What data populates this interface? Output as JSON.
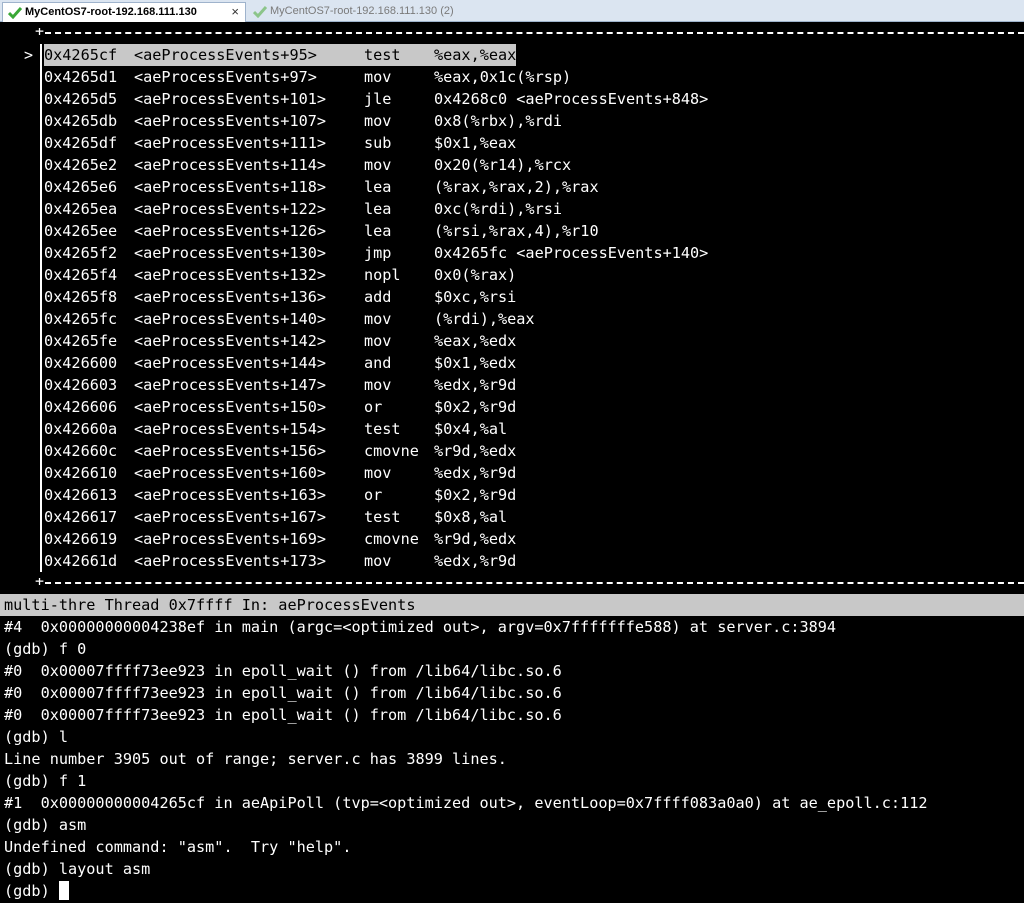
{
  "tabs": [
    {
      "label": "MyCentOS7-root-192.168.111.130",
      "close": "×",
      "active": true
    },
    {
      "label": "MyCentOS7-root-192.168.111.130 (2)",
      "active": false
    }
  ],
  "asm": {
    "current_marker": ">",
    "rows": [
      {
        "addr": "0x4265cf",
        "sym": "<aeProcessEvents+95>",
        "op": "test",
        "args": "%eax,%eax"
      },
      {
        "addr": "0x4265d1",
        "sym": "<aeProcessEvents+97>",
        "op": "mov",
        "args": "%eax,0x1c(%rsp)"
      },
      {
        "addr": "0x4265d5",
        "sym": "<aeProcessEvents+101>",
        "op": "jle",
        "args": "0x4268c0 <aeProcessEvents+848>"
      },
      {
        "addr": "0x4265db",
        "sym": "<aeProcessEvents+107>",
        "op": "mov",
        "args": "0x8(%rbx),%rdi"
      },
      {
        "addr": "0x4265df",
        "sym": "<aeProcessEvents+111>",
        "op": "sub",
        "args": "$0x1,%eax"
      },
      {
        "addr": "0x4265e2",
        "sym": "<aeProcessEvents+114>",
        "op": "mov",
        "args": "0x20(%r14),%rcx"
      },
      {
        "addr": "0x4265e6",
        "sym": "<aeProcessEvents+118>",
        "op": "lea",
        "args": "(%rax,%rax,2),%rax"
      },
      {
        "addr": "0x4265ea",
        "sym": "<aeProcessEvents+122>",
        "op": "lea",
        "args": "0xc(%rdi),%rsi"
      },
      {
        "addr": "0x4265ee",
        "sym": "<aeProcessEvents+126>",
        "op": "lea",
        "args": "(%rsi,%rax,4),%r10"
      },
      {
        "addr": "0x4265f2",
        "sym": "<aeProcessEvents+130>",
        "op": "jmp",
        "args": "0x4265fc <aeProcessEvents+140>"
      },
      {
        "addr": "0x4265f4",
        "sym": "<aeProcessEvents+132>",
        "op": "nopl",
        "args": "0x0(%rax)"
      },
      {
        "addr": "0x4265f8",
        "sym": "<aeProcessEvents+136>",
        "op": "add",
        "args": "$0xc,%rsi"
      },
      {
        "addr": "0x4265fc",
        "sym": "<aeProcessEvents+140>",
        "op": "mov",
        "args": "(%rdi),%eax"
      },
      {
        "addr": "0x4265fe",
        "sym": "<aeProcessEvents+142>",
        "op": "mov",
        "args": "%eax,%edx"
      },
      {
        "addr": "0x426600",
        "sym": "<aeProcessEvents+144>",
        "op": "and",
        "args": "$0x1,%edx"
      },
      {
        "addr": "0x426603",
        "sym": "<aeProcessEvents+147>",
        "op": "mov",
        "args": "%edx,%r9d"
      },
      {
        "addr": "0x426606",
        "sym": "<aeProcessEvents+150>",
        "op": "or",
        "args": "$0x2,%r9d"
      },
      {
        "addr": "0x42660a",
        "sym": "<aeProcessEvents+154>",
        "op": "test",
        "args": "$0x4,%al"
      },
      {
        "addr": "0x42660c",
        "sym": "<aeProcessEvents+156>",
        "op": "cmovne",
        "args": "%r9d,%edx"
      },
      {
        "addr": "0x426610",
        "sym": "<aeProcessEvents+160>",
        "op": "mov",
        "args": "%edx,%r9d"
      },
      {
        "addr": "0x426613",
        "sym": "<aeProcessEvents+163>",
        "op": "or",
        "args": "$0x2,%r9d"
      },
      {
        "addr": "0x426617",
        "sym": "<aeProcessEvents+167>",
        "op": "test",
        "args": "$0x8,%al"
      },
      {
        "addr": "0x426619",
        "sym": "<aeProcessEvents+169>",
        "op": "cmovne",
        "args": "%r9d,%edx"
      },
      {
        "addr": "0x42661d",
        "sym": "<aeProcessEvents+173>",
        "op": "mov",
        "args": "%edx,%r9d"
      }
    ]
  },
  "status_line": "multi-thre Thread 0x7ffff In: aeProcessEvents",
  "command_lines": [
    "#4  0x00000000004238ef in main (argc=<optimized out>, argv=0x7fffffffe588) at server.c:3894",
    "(gdb) f 0",
    "#0  0x00007ffff73ee923 in epoll_wait () from /lib64/libc.so.6",
    "#0  0x00007ffff73ee923 in epoll_wait () from /lib64/libc.so.6",
    "#0  0x00007ffff73ee923 in epoll_wait () from /lib64/libc.so.6",
    "(gdb) l",
    "Line number 3905 out of range; server.c has 3899 lines.",
    "(gdb) f 1",
    "#1  0x00000000004265cf in aeApiPoll (tvp=<optimized out>, eventLoop=0x7ffff083a0a0) at ae_epoll.c:112",
    "(gdb) asm",
    "Undefined command: \"asm\".  Try \"help\".",
    "(gdb) layout asm"
  ],
  "prompt": "(gdb) ",
  "colors": {
    "check": "#3aa836",
    "highlight": "#c8c8c8"
  }
}
